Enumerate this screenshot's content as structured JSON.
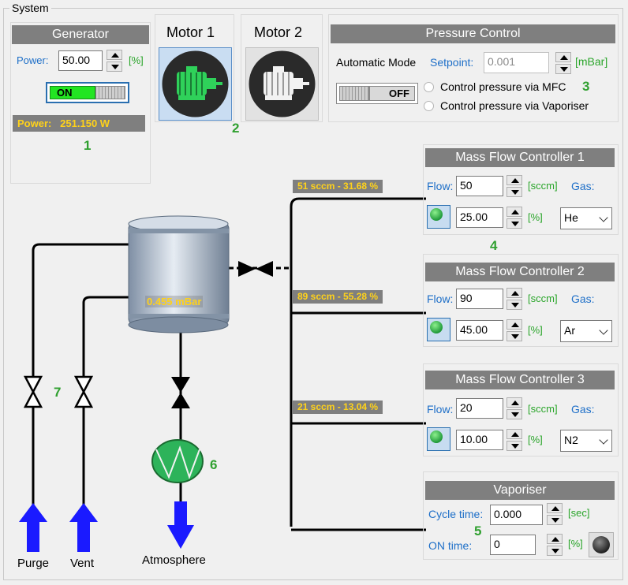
{
  "window": {
    "title": "System"
  },
  "generator": {
    "title": "Generator",
    "power_label": "Power:",
    "power_value": "50.00",
    "power_unit": "[%]",
    "toggle_label": "ON",
    "readout": "Power:   251.150 W",
    "marker": "1"
  },
  "motors": {
    "motor1_label": "Motor 1",
    "motor2_label": "Motor 2",
    "marker": "2"
  },
  "pressure_control": {
    "title": "Pressure Control",
    "mode_label": "Automatic Mode",
    "setpoint_label": "Setpoint:",
    "setpoint_value": "0.001",
    "setpoint_unit": "[mBar]",
    "toggle_label": "OFF",
    "option_mfc": "Control pressure via MFC",
    "option_vaporiser": "Control pressure via Vaporiser",
    "marker": "3"
  },
  "mfcs": [
    {
      "title": "Mass Flow Controller 1",
      "flow_label": "Flow:",
      "flow_value": "50",
      "flow_unit": "[sccm]",
      "gas_label": "Gas:",
      "percent_value": "25.00",
      "percent_unit": "[%]",
      "gas_value": "He",
      "line_label": "51 sccm - 31.68 %"
    },
    {
      "title": "Mass Flow Controller 2",
      "flow_label": "Flow:",
      "flow_value": "90",
      "flow_unit": "[sccm]",
      "gas_label": "Gas:",
      "percent_value": "45.00",
      "percent_unit": "[%]",
      "gas_value": "Ar",
      "line_label": "89 sccm - 55.28 %"
    },
    {
      "title": "Mass Flow Controller 3",
      "flow_label": "Flow:",
      "flow_value": "20",
      "flow_unit": "[sccm]",
      "gas_label": "Gas:",
      "percent_value": "10.00",
      "percent_unit": "[%]",
      "gas_value": "N2",
      "line_label": "21 sccm - 13.04 %"
    }
  ],
  "mfc_marker": "4",
  "vaporiser": {
    "title": "Vaporiser",
    "cycle_label": "Cycle time:",
    "cycle_value": "0.000",
    "cycle_unit": "[sec]",
    "on_label": "ON time:",
    "on_value": "0",
    "on_unit": "[%]",
    "marker": "5"
  },
  "chamber": {
    "pressure": "0.455 mBar"
  },
  "pump_marker": "6",
  "valves_marker": "7",
  "outlets": {
    "purge": "Purge",
    "vent": "Vent",
    "atmosphere": "Atmosphere"
  },
  "colors": {
    "panel_title_bg": "#7f7f7f",
    "accent_blue": "#1e6fc8",
    "marker_green": "#30a030",
    "arrow_blue": "#1a1aff",
    "pump_green": "#2db35a",
    "label_yellow": "#ffd21a"
  }
}
